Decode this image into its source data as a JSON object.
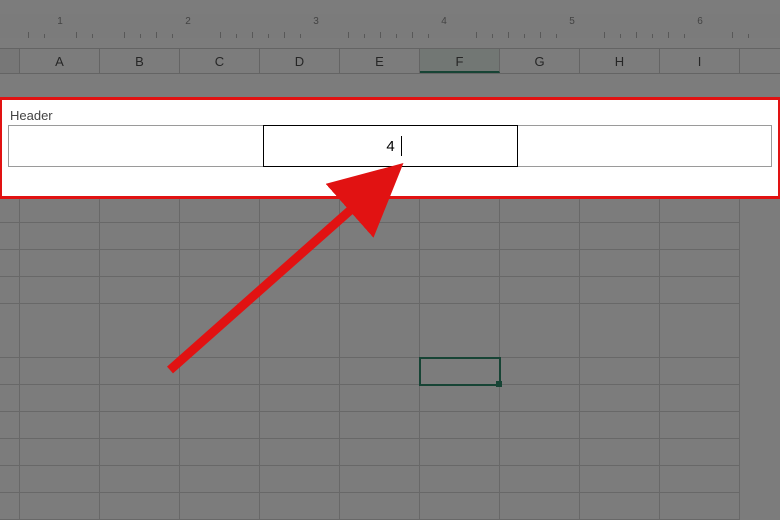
{
  "ruler": {
    "majors": [
      "1",
      "2",
      "3",
      "4",
      "5",
      "6"
    ]
  },
  "columns": [
    "A",
    "B",
    "C",
    "D",
    "E",
    "F",
    "G",
    "H",
    "I"
  ],
  "activeColumnIndex": 5,
  "headerSection": {
    "label": "Header",
    "left": "",
    "center": "4",
    "right": ""
  },
  "selectedCell": {
    "row": 6,
    "col": 5
  },
  "colors": {
    "highlight": "#e11212",
    "accent": "#0f7b56"
  }
}
